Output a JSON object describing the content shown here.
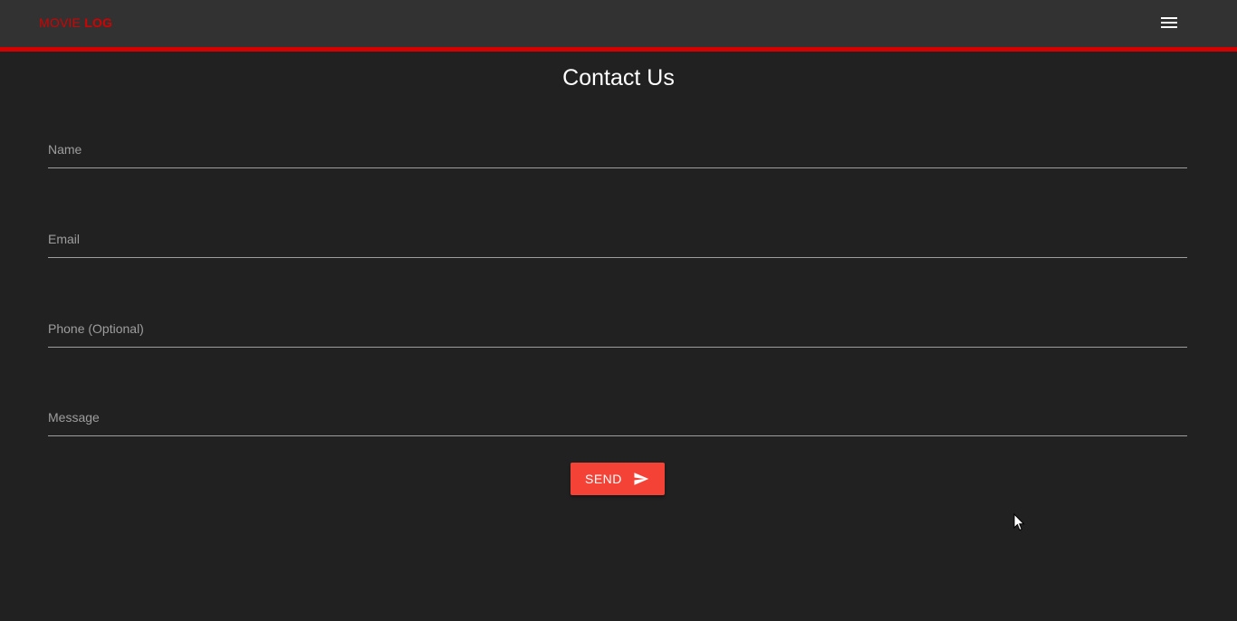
{
  "navbar": {
    "brand_part1": "MOVIE ",
    "brand_part2": "LOG",
    "menu_icon": "hamburger-menu-icon",
    "accent_color": "#d50000"
  },
  "page": {
    "title": "Contact Us"
  },
  "form": {
    "name": {
      "placeholder": "Name",
      "value": ""
    },
    "email": {
      "placeholder": "Email",
      "value": ""
    },
    "phone": {
      "placeholder": "Phone (Optional)",
      "value": ""
    },
    "message": {
      "placeholder": "Message",
      "value": ""
    },
    "send_label": "SEND",
    "send_icon": "send-icon",
    "send_color": "#f44336"
  }
}
